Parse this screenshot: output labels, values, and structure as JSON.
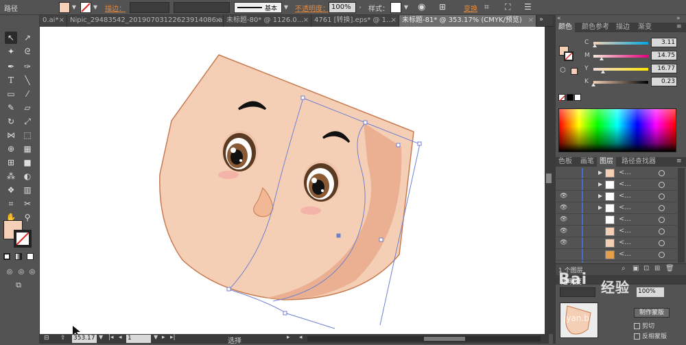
{
  "control_bar": {
    "mode_label": "路径",
    "stroke_label": "描边：",
    "stroke_profile": "基本",
    "opacity_label": "不透明度：",
    "opacity_value": "100%",
    "style_label": "样式：",
    "recolor_label": "变换",
    "fill_color": "#f6d0b6"
  },
  "tabs": [
    {
      "label": "0.ai*",
      "active": false
    },
    {
      "label": "Nipic_29483542_20190703122623914086.ai*",
      "active": false
    },
    {
      "label": "未标题-80* @ 1126.0...",
      "active": false
    },
    {
      "label": "4761 [转换].eps* @ 1...",
      "active": false
    },
    {
      "label": "未标题-81* @ 353.17% (CMYK/预览)",
      "active": true
    }
  ],
  "status": {
    "zoom": "353.17",
    "page": "1",
    "tool_name": "选择"
  },
  "color_panel": {
    "tabs": [
      "颜色",
      "颜色参考",
      "描边",
      "渐变"
    ],
    "sliders": [
      {
        "label": "C",
        "value": "3.11",
        "fraction": 0.03,
        "gradient": "linear-gradient(to right,#f6d0b6,#00a8e0)"
      },
      {
        "label": "M",
        "value": "14.75",
        "fraction": 0.15,
        "gradient": "linear-gradient(to right,#f6e6d8,#e6007e)"
      },
      {
        "label": "Y",
        "value": "16.77",
        "fraction": 0.17,
        "gradient": "linear-gradient(to right,#f3dde0,#ffe500)"
      },
      {
        "label": "K",
        "value": "0.23",
        "fraction": 0.0,
        "gradient": "linear-gradient(to right,#f6d0b6,#000000)"
      }
    ],
    "accent_color": "#f6d0b6"
  },
  "layers_panel": {
    "tabs": [
      "色板",
      "画笔",
      "图层",
      "路径查找器"
    ],
    "rows": [
      {
        "name": "<...",
        "visible": false,
        "expand": true
      },
      {
        "name": "<...",
        "visible": false,
        "expand": true
      },
      {
        "name": "<...",
        "visible": true,
        "expand": true
      },
      {
        "name": "<...",
        "visible": true,
        "expand": true
      },
      {
        "name": "<...",
        "visible": true,
        "expand": false
      },
      {
        "name": "<...",
        "visible": true,
        "expand": false
      },
      {
        "name": "<...",
        "visible": true,
        "expand": false
      },
      {
        "name": "<...",
        "visible": false,
        "expand": false
      }
    ],
    "footer_count": "1 个图层"
  },
  "transparency_panel": {
    "title": "透明度",
    "opacity_value": "100%",
    "make_mask": "制作蒙版",
    "clip_label": "剪切",
    "invert_label": "反相蒙版"
  }
}
